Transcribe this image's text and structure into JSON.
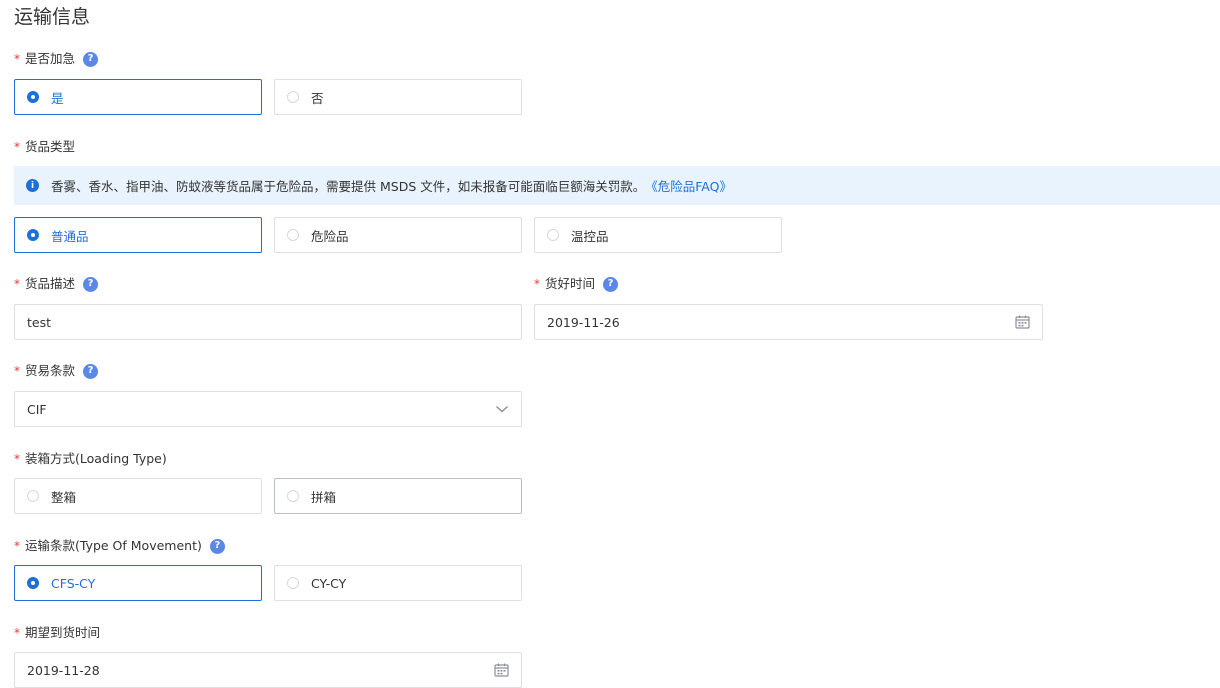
{
  "section_title": "运输信息",
  "required_mark": "*",
  "help_glyph": "?",
  "urgent": {
    "label": "是否加急",
    "options": [
      {
        "label": "是",
        "selected": true
      },
      {
        "label": "否",
        "selected": false
      }
    ]
  },
  "goods_type": {
    "label": "货品类型",
    "notice": {
      "icon_glyph": "i",
      "text": "香雾、香水、指甲油、防蚊液等货品属于危险品，需要提供 MSDS 文件，如未报备可能面临巨额海关罚款。",
      "link_text": "《危险品FAQ》"
    },
    "options": [
      {
        "label": "普通品",
        "selected": true
      },
      {
        "label": "危险品",
        "selected": false
      },
      {
        "label": "温控品",
        "selected": false
      }
    ]
  },
  "goods_desc": {
    "label": "货品描述",
    "value": "test"
  },
  "ready_time": {
    "label": "货好时间",
    "value": "2019-11-26",
    "icon": "calendar-icon"
  },
  "trade_terms": {
    "label": "贸易条款",
    "value": "CIF",
    "icon": "chevron-down-icon"
  },
  "loading_type": {
    "label": "装箱方式(Loading Type)",
    "options": [
      {
        "label": "整箱",
        "selected": false
      },
      {
        "label": "拼箱",
        "selected": false
      }
    ]
  },
  "movement": {
    "label": "运输条款(Type Of Movement)",
    "options": [
      {
        "label": "CFS-CY",
        "selected": true
      },
      {
        "label": "CY-CY",
        "selected": false
      }
    ]
  },
  "expected_arrival": {
    "label": "期望到货时间",
    "value": "2019-11-28",
    "icon": "calendar-icon"
  },
  "colors": {
    "accent": "#1f6fd6",
    "required": "#e4393c",
    "help": "#5b87e6",
    "notice_bg": "#e9f3fd"
  }
}
